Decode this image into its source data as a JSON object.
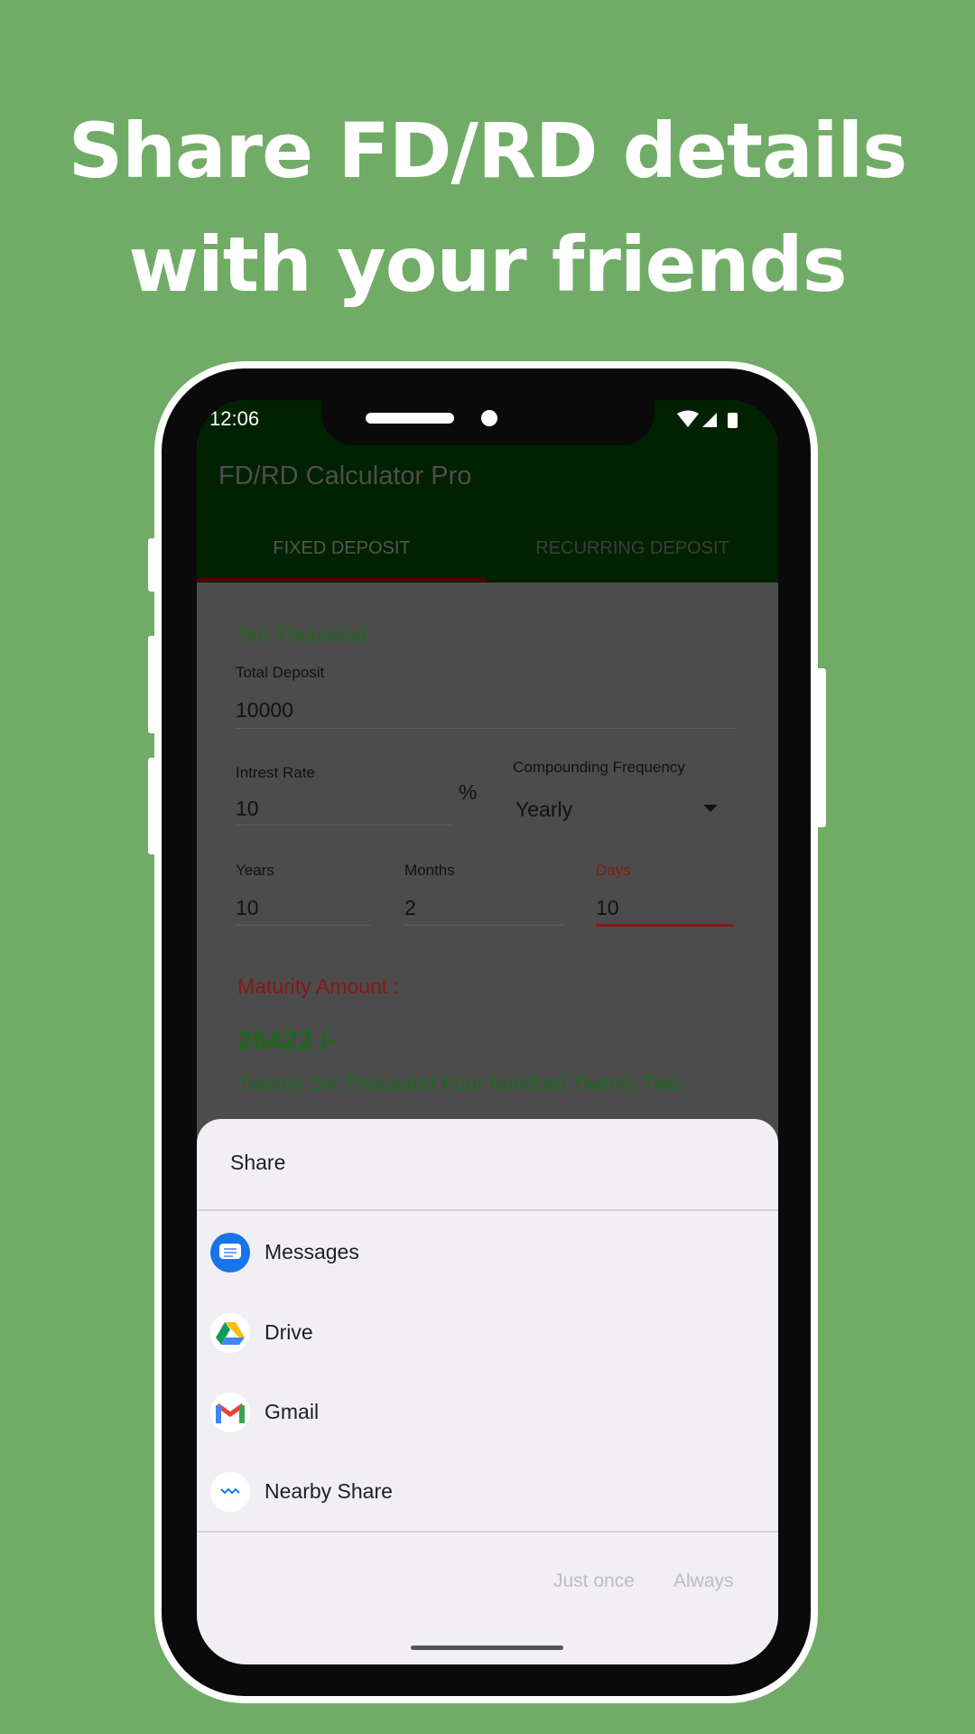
{
  "headline": {
    "line1": "Share FD/RD details",
    "line2": "with your friends"
  },
  "status_bar": {
    "time": "12:06",
    "icons": [
      "wifi-icon",
      "signal-icon",
      "battery-icon"
    ]
  },
  "app": {
    "title": "FD/RD Calculator Pro",
    "tabs": [
      {
        "label": "FIXED DEPOSIT",
        "active": true
      },
      {
        "label": "RECURRING DEPOSIT",
        "active": false
      }
    ]
  },
  "form": {
    "amount_words": "Ten Thousand",
    "total_deposit": {
      "label": "Total Deposit",
      "value": "10000"
    },
    "interest_rate": {
      "label": "Intrest Rate",
      "value": "10",
      "unit": "%"
    },
    "compounding": {
      "label": "Compounding Frequency",
      "value": "Yearly"
    },
    "years": {
      "label": "Years",
      "value": "10"
    },
    "months": {
      "label": "Months",
      "value": "2"
    },
    "days": {
      "label": "Days",
      "value": "10"
    },
    "maturity_label": "Maturity Amount :",
    "maturity_value": "26422 /-",
    "maturity_words": "Twenty Six Thousand Four hundred Twenty Two"
  },
  "share_sheet": {
    "title": "Share",
    "apps": [
      {
        "label": "Messages",
        "icon": "messages-icon"
      },
      {
        "label": "Drive",
        "icon": "drive-icon"
      },
      {
        "label": "Gmail",
        "icon": "gmail-icon"
      },
      {
        "label": "Nearby Share",
        "icon": "nearby-share-icon"
      }
    ],
    "just_once": "Just once",
    "always": "Always"
  },
  "colors": {
    "background": "#71ac67",
    "appbar": "#002200",
    "accent_red": "#a01818",
    "green_text": "#1d6a1d"
  }
}
